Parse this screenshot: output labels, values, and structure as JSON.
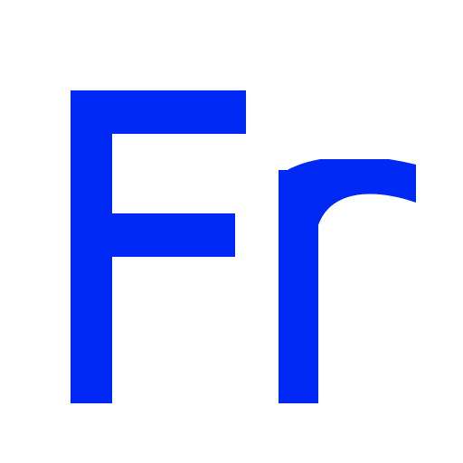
{
  "text": "Fr",
  "color": "#0028f5",
  "background": "#ffffff"
}
